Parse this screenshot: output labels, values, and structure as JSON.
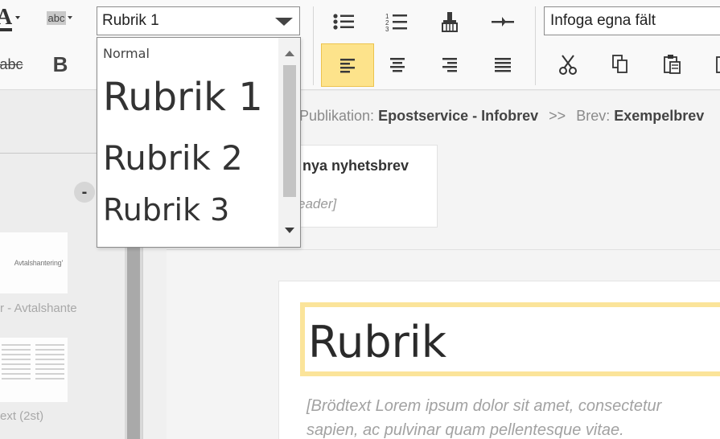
{
  "colors": {
    "accent_yellow": "#fde38b",
    "heading_border": "#fbe49a",
    "toolbar_bg": "#f9f9f9",
    "sidebar_bg": "#ededed"
  },
  "toolbar": {
    "font_color_icon": "font-color-icon",
    "highlight_label": "abc",
    "strikethrough_label": "abc",
    "bold_label": "B",
    "style_select_value": "Rubrik 1",
    "field_select_value": "Infoga egna fält",
    "icons": {
      "bullet_list": "bullet-list-icon",
      "numbered_list": "numbered-list-icon",
      "format_painter": "format-painter-icon",
      "horizontal_rule": "horizontal-rule-icon",
      "align_left": "align-left-icon",
      "align_center": "align-center-icon",
      "align_right": "align-right-icon",
      "justify": "justify-icon",
      "cut": "cut-icon",
      "copy": "copy-icon",
      "paste": "paste-icon"
    }
  },
  "dropdown": {
    "options": [
      "Normal",
      "Rubrik 1",
      "Rubrik 2",
      "Rubrik 3"
    ]
  },
  "sidebar": {
    "collapse_label": "-",
    "thumb1_text": "Avtalshantering'",
    "thumb1_label": "r - Avtalshante",
    "thumb2_label": "ext (2st)"
  },
  "breadcrumb": {
    "pub_label": "Publikation:",
    "pub_value": "Epostservice - Infobrev",
    "separator": ">>",
    "letter_label": "Brev:",
    "letter_value": "Exempelbrev"
  },
  "preview": {
    "title": "nya nyhetsbrev",
    "subtitle": "eader]"
  },
  "editor": {
    "heading": "Rubrik",
    "body_line1": "[Brödtext Lorem ipsum dolor sit amet, consectetur",
    "body_line2": "sapien, ac pulvinar quam pellentesque vitae."
  }
}
